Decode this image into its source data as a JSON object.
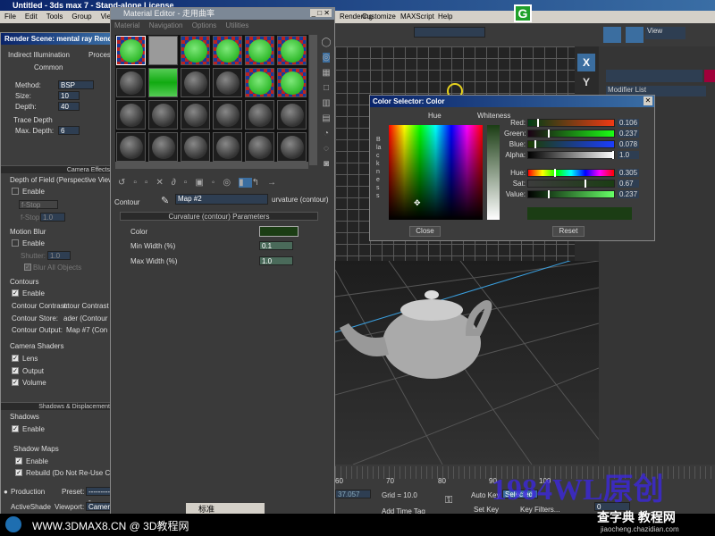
{
  "app": {
    "title": "Untitled - 3ds max 7 - Stand-alone License",
    "menu": [
      "File",
      "Edit",
      "Tools",
      "Group",
      "Views",
      "Rendering",
      "Customize",
      "MAXScript",
      "Help"
    ],
    "toolbar_view": "View",
    "modifier_list": "Modifier List",
    "axis_x": "X",
    "axis_y": "Y"
  },
  "render_scene": {
    "title": "Render Scene: mental ray Renderer",
    "tabs": [
      "Indirect Illumination",
      "Processing",
      "Common"
    ],
    "method_label": "Method:",
    "method": "BSP",
    "size_label": "Size:",
    "size": "10",
    "depth_label": "Depth:",
    "depth": "40",
    "trace_depth": "Trace Depth",
    "max_depth_label": "Max. Depth:",
    "max_depth": "6",
    "camera_effects": "Camera Effects",
    "dof": "Depth of Field (Perspective Views Only)",
    "dof_enable": "Enable",
    "fstop": "f-Stop",
    "fstop_label": "f-Stop:",
    "fstop_val": "1.0",
    "motion_blur": "Motion Blur",
    "mb_enable": "Enable",
    "shutter_label": "Shutter:",
    "shutter": "1.0",
    "blur_all": "Blur All Objects",
    "contours": "Contours",
    "contours_enable": "Enable",
    "contour_contrast_label": "Contour Contrast:",
    "contour_contrast": "ntour Contrast F",
    "contour_store_label": "Contour Store:",
    "contour_store": "ader (Contour",
    "contour_output_label": "Contour Output:",
    "contour_output": "Map #7 (Con",
    "camera_shaders": "Camera Shaders",
    "lens": "Lens",
    "output": "Output",
    "volume": "Volume",
    "shadows_disp": "Shadows & Displacement",
    "shadows": "Shadows",
    "shadows_enable": "Enable",
    "shadow_maps": "Shadow Maps",
    "sm_enable": "Enable",
    "rebuild": "Rebuild (Do Not Re-Use Cache)",
    "production": "Production",
    "activeshade": "ActiveShade",
    "preset_label": "Preset:",
    "preset": "----------",
    "viewport_label": "Viewport:",
    "viewport": "Camera"
  },
  "material_editor": {
    "title": "Material Editor - 走用曲率",
    "menu": [
      "Material",
      "Navigation",
      "Options",
      "Utilities"
    ],
    "slots": [
      "green-checker",
      "gray",
      "green-checker",
      "green-checker",
      "green-checker",
      "green-checker",
      "dark",
      "green",
      "dark",
      "dark",
      "green-checker",
      "green-checker",
      "dark",
      "dark",
      "dark",
      "dark",
      "dark",
      "dark",
      "dark",
      "dark",
      "dark",
      "dark",
      "dark",
      "dark"
    ],
    "contour_label": "Contour",
    "map_name": "Map #2",
    "map_type": "urvature (contour)",
    "rollout": "Curvature (contour) Parameters",
    "color_label": "Color",
    "color_value": "#1b3d14",
    "min_width_label": "Min Width (%)",
    "min_width": "0.1",
    "max_width_label": "Max Width (%)",
    "max_width": "1.0",
    "ime": "标准"
  },
  "color_selector": {
    "title": "Color Selector: Color",
    "hue_label": "Hue",
    "whiteness_label": "Whiteness",
    "blackness_label": "Blackness",
    "channels": [
      {
        "label": "Red:",
        "value": "0.106",
        "fraction": 0.106
      },
      {
        "label": "Green:",
        "value": "0.237",
        "fraction": 0.237
      },
      {
        "label": "Blue:",
        "value": "0.078",
        "fraction": 0.078
      },
      {
        "label": "Alpha:",
        "value": "1.0",
        "fraction": 1.0
      }
    ],
    "hsv": [
      {
        "label": "Hue:",
        "value": "0.305",
        "fraction": 0.305
      },
      {
        "label": "Sat:",
        "value": "0.67",
        "fraction": 0.67
      },
      {
        "label": "Value:",
        "value": "0.237",
        "fraction": 0.237
      }
    ],
    "close": "Close",
    "reset": "Reset",
    "swatch": "#1b3d14"
  },
  "timeline": {
    "ticks": [
      "60",
      "70",
      "80",
      "90",
      "100"
    ],
    "coord": "37.057",
    "grid": "Grid = 10.0",
    "add_time_tag": "Add Time Tag",
    "auto_key": "Auto Key",
    "selected": "Selected",
    "set_key": "Set Key",
    "key_filters": "Key Filters...",
    "frame": "0"
  },
  "watermark": {
    "left": "WWW.3DMAX8.CN @ 3D教程网",
    "overlay": "1984WL原创",
    "right": "查字典 教程网",
    "right_url": "jiaocheng.chazidian.com"
  }
}
